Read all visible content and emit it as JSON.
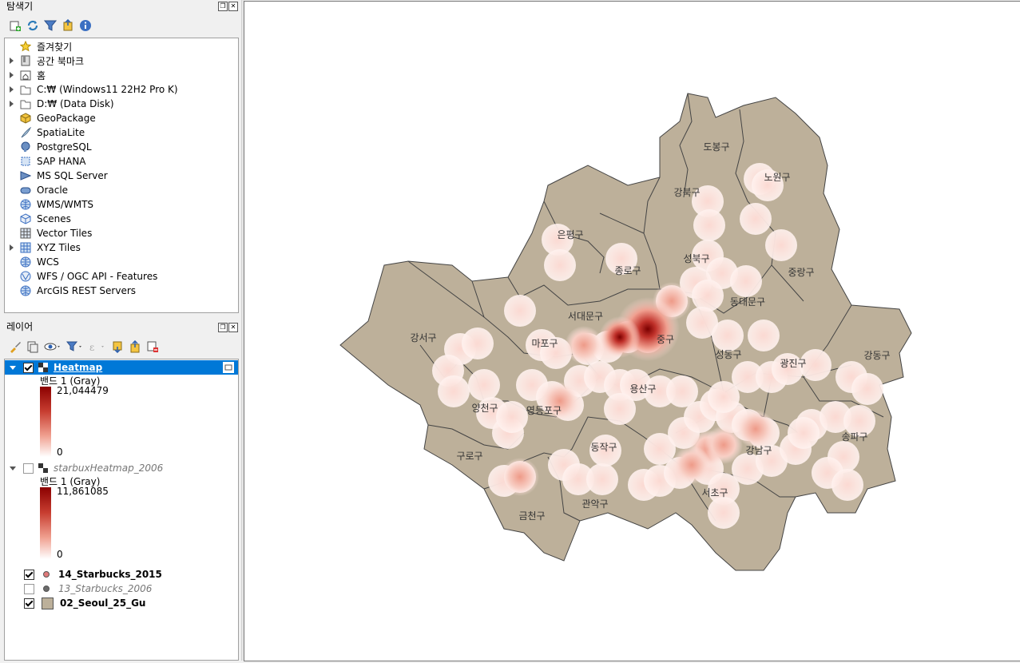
{
  "browser": {
    "title": "탐색기",
    "items": [
      {
        "label": "즐겨찾기",
        "expandable": false,
        "icon": "star-icon"
      },
      {
        "label": "공간 북마크",
        "expandable": true,
        "icon": "bookmark-icon"
      },
      {
        "label": "홈",
        "expandable": true,
        "icon": "home-folder-icon"
      },
      {
        "label": "C:₩ (Windows11 22H2 Pro K)",
        "expandable": true,
        "icon": "folder-icon"
      },
      {
        "label": "D:₩ (Data Disk)",
        "expandable": true,
        "icon": "folder-icon"
      },
      {
        "label": "GeoPackage",
        "expandable": false,
        "icon": "geopackage-icon"
      },
      {
        "label": "SpatiaLite",
        "expandable": false,
        "icon": "spatialite-icon"
      },
      {
        "label": "PostgreSQL",
        "expandable": false,
        "icon": "postgresql-icon"
      },
      {
        "label": "SAP HANA",
        "expandable": false,
        "icon": "sap-hana-icon"
      },
      {
        "label": "MS SQL Server",
        "expandable": false,
        "icon": "mssql-icon"
      },
      {
        "label": "Oracle",
        "expandable": false,
        "icon": "oracle-icon"
      },
      {
        "label": "WMS/WMTS",
        "expandable": false,
        "icon": "globe-icon"
      },
      {
        "label": "Scenes",
        "expandable": false,
        "icon": "scenes-icon"
      },
      {
        "label": "Vector Tiles",
        "expandable": false,
        "icon": "vector-tiles-icon"
      },
      {
        "label": "XYZ Tiles",
        "expandable": true,
        "icon": "xyz-tiles-icon"
      },
      {
        "label": "WCS",
        "expandable": false,
        "icon": "globe-icon"
      },
      {
        "label": "WFS / OGC API - Features",
        "expandable": false,
        "icon": "wfs-icon"
      },
      {
        "label": "ArcGIS REST Servers",
        "expandable": false,
        "icon": "globe-icon"
      }
    ]
  },
  "layers": {
    "title": "레이어",
    "heatmap": {
      "name": "Heatmap",
      "band": "밴드 1 (Gray)",
      "max": "21,044479",
      "min": "0",
      "checked": true
    },
    "starbux": {
      "name": "starbuxHeatmap_2006",
      "band": "밴드 1 (Gray)",
      "max": "11,861085",
      "min": "0",
      "checked": false
    },
    "vectors": [
      {
        "name": "14_Starbucks_2015",
        "checked": true,
        "italic": false,
        "color": "#e07a7a",
        "kind": "point"
      },
      {
        "name": "13_Starbucks_2006",
        "checked": false,
        "italic": true,
        "color": "#6b6b6b",
        "kind": "point"
      },
      {
        "name": "02_Seoul_25_Gu",
        "checked": true,
        "italic": false,
        "color": "#bcb09a",
        "kind": "polygon"
      }
    ]
  },
  "map": {
    "fill_color": "#bdb09a",
    "districts": [
      "도봉구",
      "노원구",
      "강북구",
      "은평구",
      "성북구",
      "종로구",
      "중랑구",
      "동대문구",
      "서대문구",
      "강서구",
      "마포구",
      "중구",
      "성동구",
      "광진구",
      "강동구",
      "용산구",
      "양천구",
      "영등포구",
      "송파구",
      "동작구",
      "강남구",
      "구로구",
      "서초구",
      "금천구",
      "관악구"
    ]
  }
}
